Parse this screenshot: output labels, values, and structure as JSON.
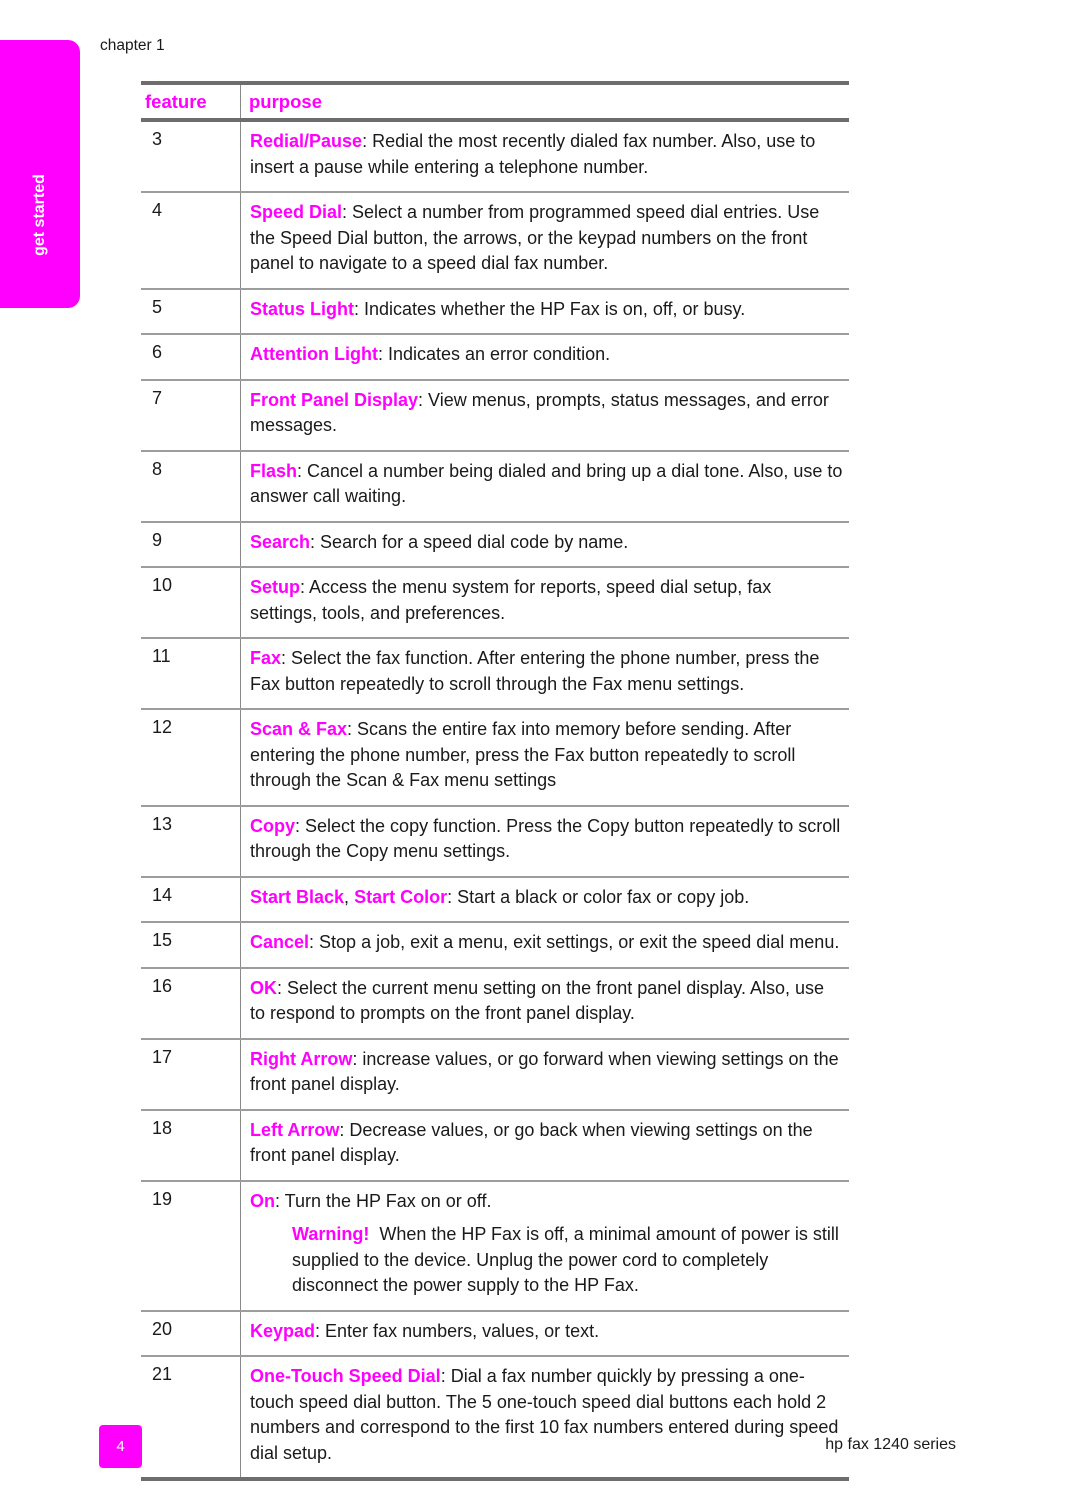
{
  "side_tab": {
    "label": "get started"
  },
  "header": {
    "chapter": "chapter 1"
  },
  "table": {
    "columns": [
      "feature",
      "purpose"
    ],
    "rows": [
      {
        "feature": "3",
        "term": "Redial/Pause",
        "text": ": Redial the most recently dialed fax number. Also, use to insert a pause while entering a telephone number."
      },
      {
        "feature": "4",
        "term": "Speed Dial",
        "text": ": Select a number from programmed speed dial entries. Use the Speed Dial button, the arrows, or the keypad numbers on the front panel to navigate to a speed dial fax number."
      },
      {
        "feature": "5",
        "term": "Status Light",
        "text": ": Indicates whether the HP Fax is on, off, or busy."
      },
      {
        "feature": "6",
        "term": "Attention Light",
        "text": ": Indicates an error condition."
      },
      {
        "feature": "7",
        "term": "Front Panel Display",
        "text": ": View menus, prompts, status messages, and error messages."
      },
      {
        "feature": "8",
        "term": "Flash",
        "text": ": Cancel a number being dialed and bring up a dial tone. Also, use to answer call waiting."
      },
      {
        "feature": "9",
        "term": "Search",
        "text": ": Search for a speed dial code by name."
      },
      {
        "feature": "10",
        "term": "Setup",
        "text": ": Access the menu system for reports, speed dial setup, fax settings, tools, and preferences."
      },
      {
        "feature": "11",
        "term": "Fax",
        "text": ": Select the fax function. After entering the phone number, press the Fax button repeatedly to scroll through the Fax menu settings."
      },
      {
        "feature": "12",
        "term": "Scan & Fax",
        "text": ": Scans the entire fax into memory before sending. After entering the phone number, press the Fax button repeatedly to scroll through the Scan & Fax menu settings"
      },
      {
        "feature": "13",
        "term": "Copy",
        "text": ": Select the copy function. Press the Copy button repeatedly to scroll through the Copy menu settings."
      },
      {
        "feature": "14",
        "term": "Start Black",
        "sep": ", ",
        "term2": "Start Color",
        "text": ": Start a black or color fax or copy job."
      },
      {
        "feature": "15",
        "term": "Cancel",
        "text": ": Stop a job, exit a menu, exit settings, or exit the speed dial menu."
      },
      {
        "feature": "16",
        "term": "OK",
        "text": ": Select the current menu setting on the front panel display. Also, use to respond to prompts on the front panel display."
      },
      {
        "feature": "17",
        "term": "Right Arrow",
        "text": ": increase values, or go forward when viewing settings on the front panel display."
      },
      {
        "feature": "18",
        "term": "Left Arrow",
        "text": ": Decrease values, or go back when viewing settings on the front panel display."
      },
      {
        "feature": "19",
        "term": "On",
        "text": ": Turn the HP Fax on or off.",
        "warning_label": "Warning!",
        "warning_text": "  When the HP Fax is off, a minimal amount of power is still supplied to the device. Unplug the power cord to completely disconnect the power supply to the HP Fax."
      },
      {
        "feature": "20",
        "term": "Keypad",
        "text": ": Enter fax numbers, values, or text."
      },
      {
        "feature": "21",
        "term": "One-Touch Speed Dial",
        "text": ": Dial a fax number quickly by pressing a one-touch speed dial button. The 5 one-touch speed dial buttons each hold 2 numbers and correspond to the first 10 fax numbers entered during speed dial setup."
      }
    ]
  },
  "footer": {
    "page_number": "4",
    "product": "hp fax 1240 series"
  },
  "colors": {
    "accent": "#ff00ff",
    "rule": "#6d6d6d",
    "divider": "#9d9d9d"
  }
}
